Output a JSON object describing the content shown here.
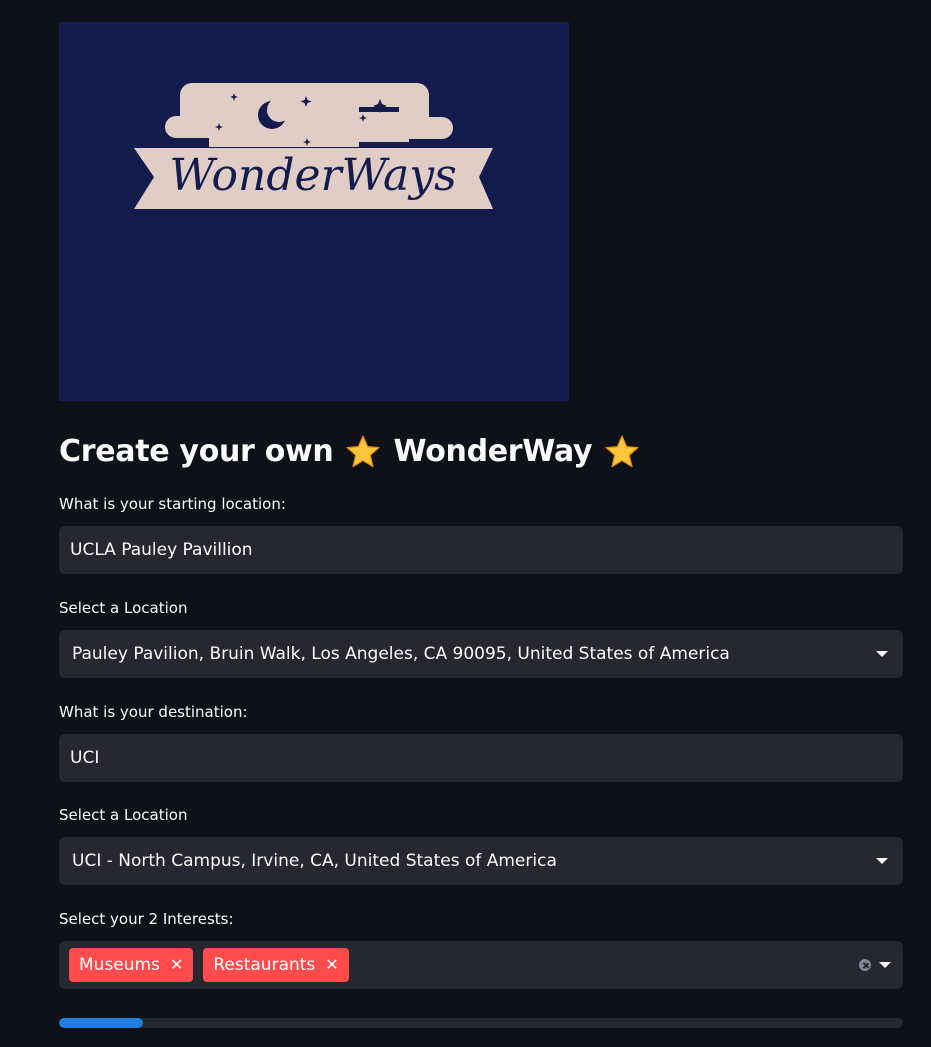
{
  "logo": {
    "text": "WonderWays",
    "background": "#141b4d",
    "banner_color": "#dfcdc6"
  },
  "header": {
    "title_part1": "Create your own",
    "title_part2": "WonderWay",
    "icon": "star-icon"
  },
  "start": {
    "label": "What is your starting location:",
    "value": "UCLA Pauley Pavillion"
  },
  "start_select": {
    "label": "Select a Location",
    "value": "Pauley Pavilion, Bruin Walk, Los Angeles, CA 90095, United States of America"
  },
  "destination": {
    "label": "What is your destination:",
    "value": "UCI"
  },
  "dest_select": {
    "label": "Select a Location",
    "value": "UCI - North Campus, Irvine, CA, United States of America"
  },
  "interests": {
    "label": "Select your 2 Interests:",
    "tags": [
      "Museums",
      "Restaurants"
    ],
    "tag_color": "#ff4b4b"
  },
  "progress": {
    "fraction": 0.1,
    "color": "#1f7fe0"
  }
}
